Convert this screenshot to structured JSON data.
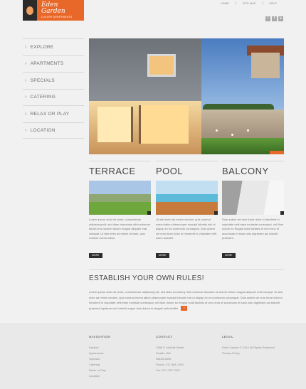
{
  "brand": {
    "name": "Eden Garden",
    "tagline": "LUXURY APARTMENTS"
  },
  "top_nav": [
    "HOME",
    "SITE MAP",
    "HELP"
  ],
  "social": [
    "t",
    "f",
    "rss"
  ],
  "sidebar": {
    "items": [
      {
        "label": "EXPLORE"
      },
      {
        "label": "APARTMENTS"
      },
      {
        "label": "SPECIALS"
      },
      {
        "label": "CATERING"
      },
      {
        "label": "RELAX OR PLAY"
      },
      {
        "label": "LOCATION"
      }
    ]
  },
  "features": [
    {
      "title": "TERRACE",
      "text": "Lorem ipsum dolor sit amet, consectetuer adipiscing elit, sed diam nonummy nibh euismod tincidunt ut laoreet dolore magna aliquam erat volutpat. Ut wisi enim ad minim veniam, quis nostrud exerci tation.",
      "button": "MORE"
    },
    {
      "title": "POOL",
      "text": "Ut wisi enim ad minim veniam, quis nostrud exerci tation ullamcorper suscipit lobortis nisl ut aliquip ex ea commodo consequat. Duis autem vel eum iriure dolor in hendrerit in vulputate velit esse molestie.",
      "button": "MORE"
    },
    {
      "title": "BALCONY",
      "text": "Duis autem vel eum iriure dolor in hendrerit in vulputate velit esse molestie consequat, vel illum dolore eu feugiat nulla facilisis at vero eros et accumsan et iusto odio dignissim qui blandit praesent.",
      "button": "MORE"
    }
  ],
  "establish": {
    "title": "ESTABLISH YOUR OWN RULES!",
    "text": "Lorem ipsum dolor sit amet, consectetuer adipiscing elit, sed diam nonummy nibh euismod tincidunt ut laoreet dolore magna aliquam erat volutpat. Ut wisi enim ad minim veniam, quis nostrud exerci tation ullamcorper suscipit lobortis nisl ut aliquip ex ea commodo consequat. Duis autem vel eum iriure dolor in hendrerit in vulputate velit esse molestie consequat, vel illum dolore eu feugiat nulla facilisis at vero eros et accumsan et iusto odio dignissim qui blandit praesent luptatum zzril delenit augue duis dolore te feugait nulla facilisi."
  },
  "footer": {
    "navigation": {
      "heading": "NAVIGATION",
      "items": [
        "Explore",
        "Apartments",
        "Specials",
        "Catering",
        "Relax or Play",
        "Location"
      ]
    },
    "contact": {
      "heading": "CONTACT",
      "lines": [
        "2356 S. Norfolk Street",
        "Seattle, WA",
        "98183-5698",
        "Phone: 217-584-7493",
        "Fax: 217-762-7962"
      ]
    },
    "legal": {
      "heading": "LEGAL",
      "lines": [
        "Eden Garden © 2012 All Rights Reserved",
        "Privacy Policy"
      ]
    }
  },
  "colors": {
    "accent": "#e8682a",
    "dark": "#2b2b2b",
    "background": "#f1f1f1"
  }
}
